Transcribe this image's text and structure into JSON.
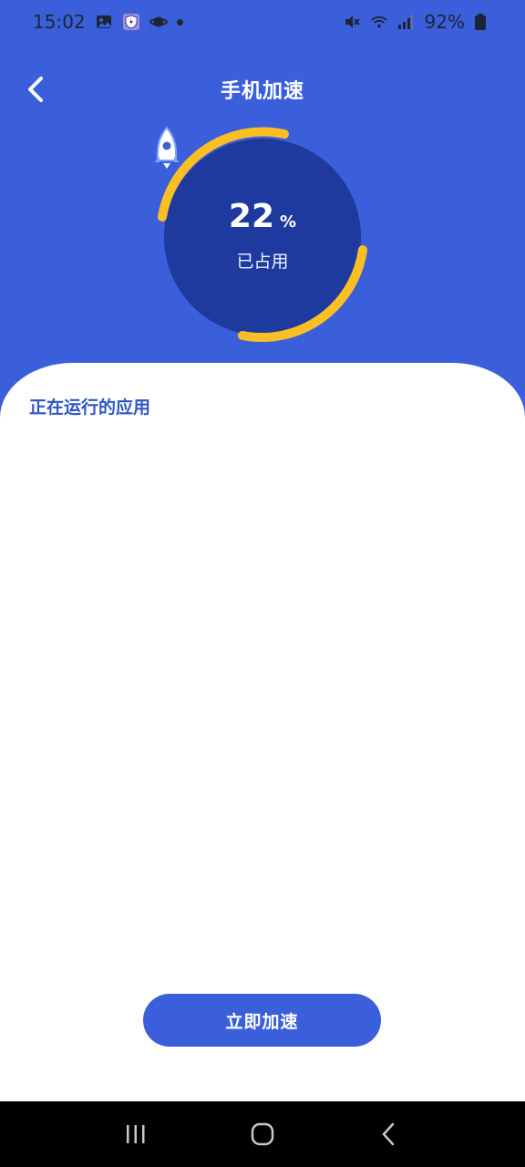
{
  "status_bar": {
    "time": "15:02",
    "battery": "92%",
    "left_icons": [
      "gallery-icon",
      "shield-app-icon",
      "planet-app-icon",
      "notification-dot"
    ],
    "right_icons": [
      "mute-icon",
      "wifi-icon",
      "signal-icon",
      "battery-icon"
    ]
  },
  "header": {
    "title": "手机加速",
    "back_icon": "chevron-left-icon"
  },
  "gauge": {
    "value": "22",
    "unit": "%",
    "label": "已占用",
    "fraction": 0.22,
    "arc_color": "#fbbf24",
    "circle_color": "#1e3a9e",
    "icon": "rocket-icon"
  },
  "content": {
    "section_title": "正在运行的应用",
    "action_label": "立即加速"
  },
  "navigation": {
    "icons": [
      "recent-apps-icon",
      "home-icon",
      "back-icon"
    ]
  },
  "colors": {
    "primary": "#3b5fdb",
    "accent": "#fbbf24",
    "section_title": "#2e56c7"
  }
}
